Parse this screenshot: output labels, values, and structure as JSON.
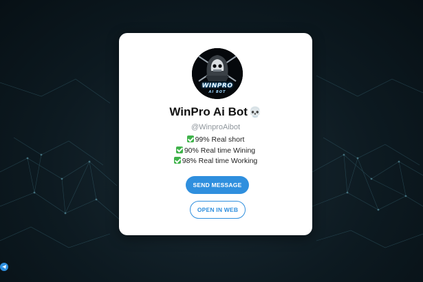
{
  "bot": {
    "name": "WinPro Ai Bot",
    "name_emoji": "💀",
    "username": "@WinproAibot",
    "avatar_text_main": "WINPRO",
    "avatar_text_sub": "AI BOT",
    "features": [
      "99% Real short",
      "90% Real time Wining",
      "98% Real time Working"
    ]
  },
  "actions": {
    "send_message": "SEND MESSAGE",
    "open_in_web": "OPEN IN WEB"
  },
  "colors": {
    "accent": "#2f8fde",
    "check": "#3fb24a",
    "background": "#0d1a21"
  },
  "icons": {
    "feature_check": "check-mark-icon",
    "corner": "telegram-logo-icon"
  }
}
